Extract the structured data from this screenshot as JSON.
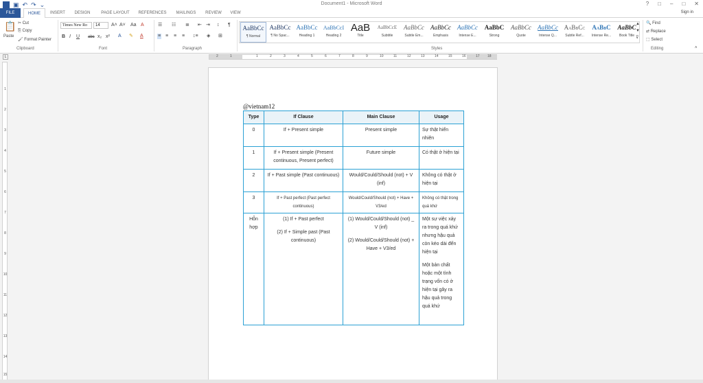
{
  "window": {
    "title": "Document1 - Microsoft Word",
    "help": "?",
    "restore_ribbon": "□",
    "minimize": "–",
    "maximize": "□",
    "close": "✕"
  },
  "qat": {
    "undo": "↶",
    "redo": "↷",
    "save": "💾",
    "more": "⌄"
  },
  "tabs": [
    "FILE",
    "HOME",
    "INSERT",
    "DESIGN",
    "PAGE LAYOUT",
    "REFERENCES",
    "MAILINGS",
    "REVIEW",
    "VIEW"
  ],
  "signin": "Sign in",
  "clipboard": {
    "paste": "Paste",
    "cut": "Cut",
    "copy": "Copy",
    "format_painter": "Format Painter",
    "label": "Clipboard"
  },
  "font": {
    "name": "Times New Ro",
    "size": "14",
    "label": "Font",
    "bold": "B",
    "italic": "I",
    "underline": "U",
    "strike": "abc",
    "sub": "x₂",
    "sup": "x²",
    "grow": "A˄",
    "shrink": "A˅",
    "case": "Aa",
    "clear": "A"
  },
  "paragraph": {
    "label": "Paragraph",
    "pilcrow": "¶"
  },
  "styles": {
    "label": "Styles",
    "items": [
      {
        "sample": "AaBbCc",
        "name": "¶ Normal"
      },
      {
        "sample": "AaBbCc",
        "name": "¶ No Spac..."
      },
      {
        "sample": "AaBbCc",
        "name": "Heading 1"
      },
      {
        "sample": "AaBbCcI",
        "name": "Heading 2"
      },
      {
        "sample": "AaB",
        "name": "Title"
      },
      {
        "sample": "AaBbCcE",
        "name": "Subtitle"
      },
      {
        "sample": "AaBbCc",
        "name": "Subtle Em..."
      },
      {
        "sample": "AaBbCc",
        "name": "Emphasis"
      },
      {
        "sample": "AaBbCc",
        "name": "Intense E..."
      },
      {
        "sample": "AaBbC",
        "name": "Strong"
      },
      {
        "sample": "AaBbCc",
        "name": "Quote"
      },
      {
        "sample": "AaBbCc",
        "name": "Intense Q..."
      },
      {
        "sample": "AaBbCc",
        "name": "Subtle Ref..."
      },
      {
        "sample": "AaBbC",
        "name": "Intense Re..."
      },
      {
        "sample": "AaBbC",
        "name": "Book Title"
      }
    ]
  },
  "editing": {
    "find": "Find",
    "replace": "Replace",
    "select": "Select",
    "label": "Editing"
  },
  "ruler": {
    "h_numbers": [
      "2",
      "1",
      "1",
      "2",
      "3",
      "4",
      "5",
      "6",
      "7",
      "8",
      "9",
      "10",
      "11",
      "12",
      "13",
      "14",
      "15",
      "16",
      "17",
      "18"
    ],
    "v_numbers": [
      "1",
      "2",
      "3",
      "4",
      "5",
      "6",
      "7",
      "8",
      "9",
      "10",
      "11",
      "12",
      "13",
      "14",
      "15"
    ]
  },
  "document": {
    "watermark": "@vietnam12",
    "headers": [
      "Type",
      "If Clause",
      "Main Clause",
      "Usage"
    ],
    "rows": [
      {
        "type": "0",
        "if": [
          "If + Present simple"
        ],
        "main": [
          "Present simple"
        ],
        "usage": [
          "Sự thật hiển nhiên"
        ]
      },
      {
        "type": "1",
        "if": [
          "If + Present simple (Present continuous, Present perfect)"
        ],
        "main": [
          "Future simple"
        ],
        "usage": [
          "Có thật ở hiện tại"
        ]
      },
      {
        "type": "2",
        "if": [
          "If + Past simple (Past continuous)"
        ],
        "main": [
          "Would/Could/Should (not) + V (inf)"
        ],
        "usage": [
          "Không có thật ở hiện tại"
        ]
      },
      {
        "type": "3",
        "if": [
          "If + Past perfect (Past perfect continuous)"
        ],
        "main": [
          "Would/Could/Should (not) + Have + V3/ed"
        ],
        "usage": [
          "Không có thật trong quá khứ"
        ]
      },
      {
        "type": "Hỗn hợp",
        "if": [
          "(1) If + Past perfect",
          "(2) If + Simple past (Past continuous)"
        ],
        "main": [
          "(1) Would/Could/Should (not) _ V (inf)",
          "(2) Would/Could/Should (not) + Have + V3/ed"
        ],
        "usage": [
          "Một sự việc xảy ra trong quá khứ nhưng hậu quả còn kéo dài đến hiện tại",
          "Một bản chất hoặc một tình trạng vốn có ở hiện tại gây ra hậu quả trong quá khứ"
        ]
      }
    ]
  },
  "colors": {
    "accent": "#2b579a",
    "table_border": "#2aa0d4"
  }
}
